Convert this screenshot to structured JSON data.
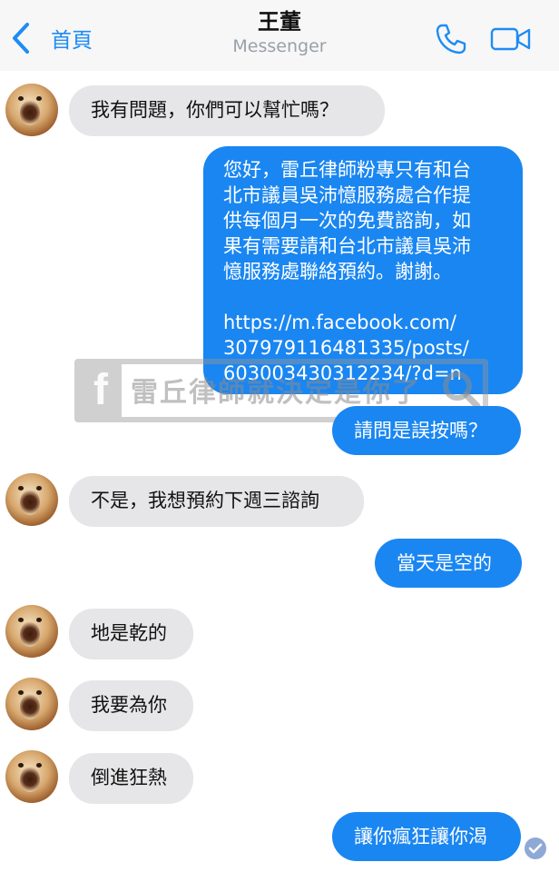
{
  "header": {
    "back_label": "首頁",
    "contact_name": "王董",
    "app_name": "Messenger",
    "back_icon": "chevron-left-icon",
    "call_icon": "phone-icon",
    "video_icon": "video-camera-icon"
  },
  "colors": {
    "accent": "#1e8cf3",
    "outgoing_bubble": "#1a86f1",
    "incoming_bubble": "#e6e6e8"
  },
  "messages": [
    {
      "from": "contact",
      "text": "我有問題，你們可以幫忙嗎？"
    },
    {
      "from": "me",
      "text": "您好，雷丘律師粉專只有和台\n北市議員吳沛憶服務處合作提\n供每個月一次的免費諮詢，如\n果有需要請和台北市議員吳沛\n憶服務處聯絡預約。謝謝。\n\nhttps://m.facebook.com/\n307979116481335/posts/\n603003430312234/?d=n"
    },
    {
      "from": "me",
      "text": "請問是誤按嗎？"
    },
    {
      "from": "contact",
      "text": "不是，我想預約下週三諮詢"
    },
    {
      "from": "me",
      "text": "當天是空的"
    },
    {
      "from": "contact",
      "text": "地是乾的"
    },
    {
      "from": "contact",
      "text": "我要為你"
    },
    {
      "from": "contact",
      "text": "倒進狂熱"
    },
    {
      "from": "me",
      "text": "讓你瘋狂讓你渴"
    }
  ],
  "watermark": {
    "text": "雷丘律師就決定是你了",
    "logo_letter": "f"
  }
}
